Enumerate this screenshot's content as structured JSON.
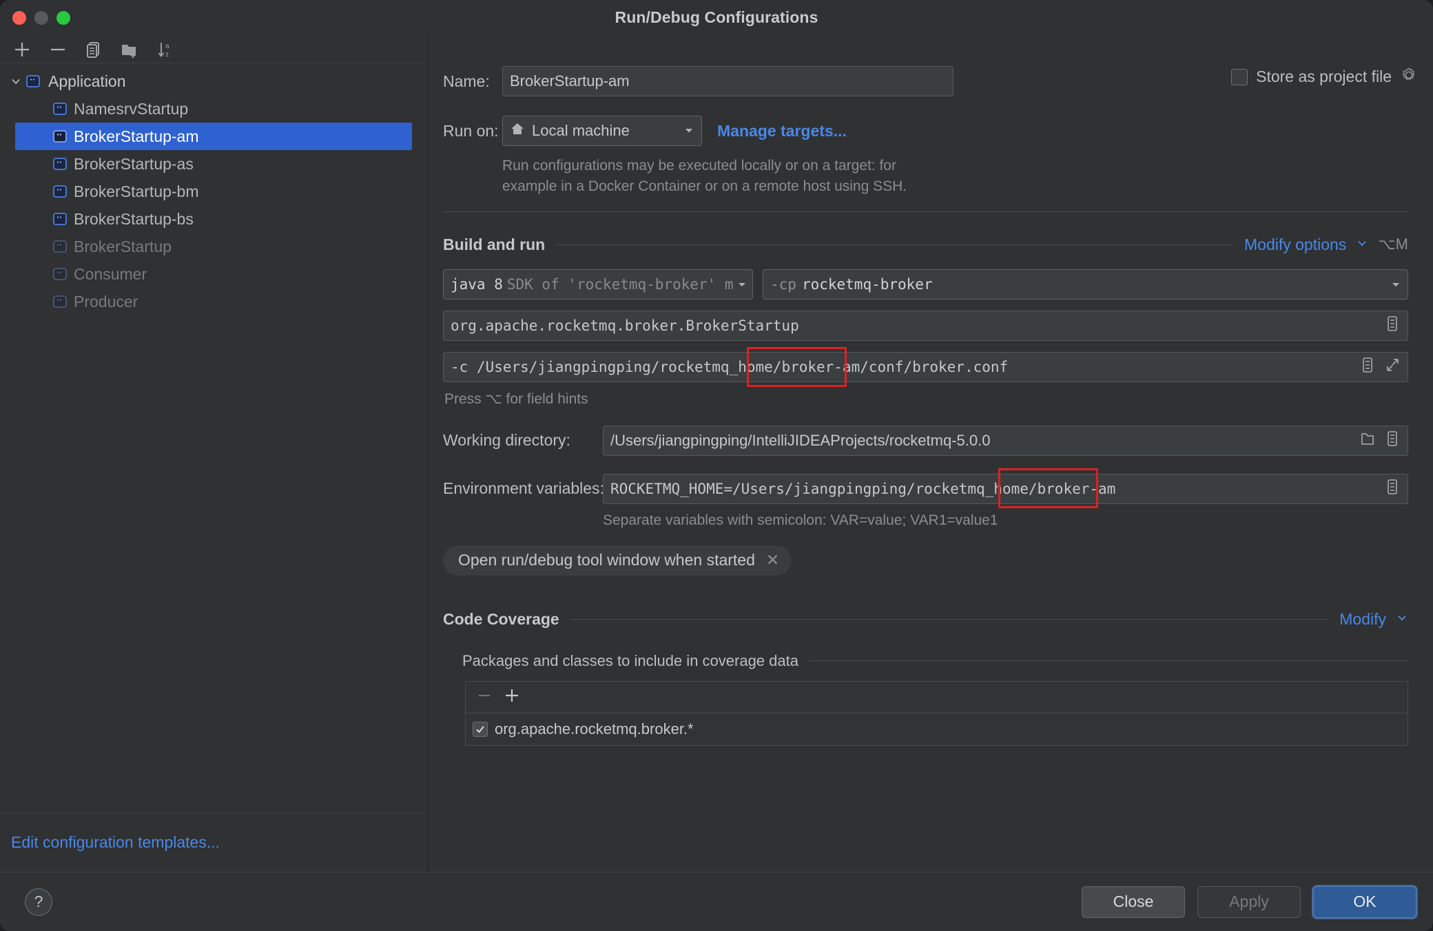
{
  "window": {
    "title": "Run/Debug Configurations",
    "traffic": {
      "close": "close-button",
      "minimize": "minimize-button",
      "zoom": "zoom-button"
    }
  },
  "sidebar": {
    "toolbar": [
      {
        "name": "add-configuration-button",
        "icon": "plus-icon"
      },
      {
        "name": "remove-configuration-button",
        "icon": "minus-icon"
      },
      {
        "name": "copy-configuration-button",
        "icon": "copy-icon"
      },
      {
        "name": "new-folder-button",
        "icon": "folder-add-icon"
      },
      {
        "name": "sort-configurations-button",
        "icon": "sort-az-icon"
      }
    ],
    "group": {
      "label": "Application",
      "expanded": true
    },
    "items": [
      {
        "label": "NamesrvStartup",
        "selected": false,
        "dimmed": false
      },
      {
        "label": "BrokerStartup-am",
        "selected": true,
        "dimmed": false
      },
      {
        "label": "BrokerStartup-as",
        "selected": false,
        "dimmed": false
      },
      {
        "label": "BrokerStartup-bm",
        "selected": false,
        "dimmed": false
      },
      {
        "label": "BrokerStartup-bs",
        "selected": false,
        "dimmed": false
      },
      {
        "label": "BrokerStartup",
        "selected": false,
        "dimmed": true
      },
      {
        "label": "Consumer",
        "selected": false,
        "dimmed": true
      },
      {
        "label": "Producer",
        "selected": false,
        "dimmed": true
      }
    ],
    "edit_templates_link": "Edit configuration templates..."
  },
  "form": {
    "name_label": "Name:",
    "name_value": "BrokerStartup-am",
    "store_as_project_file_label": "Store as project file",
    "store_as_project_file_checked": false,
    "run_on_label": "Run on:",
    "run_on_value": "Local machine",
    "manage_targets_link": "Manage targets...",
    "run_on_hint_line1": "Run configurations may be executed locally or on a target: for",
    "run_on_hint_line2": "example in a Docker Container or on a remote host using SSH."
  },
  "build_and_run": {
    "section_title": "Build and run",
    "modify_options_link": "Modify options",
    "modify_options_shortcut": "⌥M",
    "sdk_primary": "java 8",
    "sdk_secondary": "SDK of 'rocketmq-broker' mo",
    "classpath_flag": "-cp",
    "classpath_value": "rocketmq-broker",
    "main_class": "org.apache.rocketmq.broker.BrokerStartup",
    "program_arguments_prefix": "-c /Users/jiangpingping/rocketmq_home",
    "program_arguments_highlight": "/broker-am/",
    "program_arguments_suffix": "conf/broker.conf",
    "field_hints": "Press ⌥ for field hints",
    "working_directory_label": "Working directory:",
    "working_directory_value": "/Users/jiangpingping/IntelliJIDEAProjects/rocketmq-5.0.0",
    "environment_variables_label": "Environment variables:",
    "environment_variables_prefix": "ROCKETMQ_HOME=/Users/jiangpingping/rocketmq_home",
    "environment_variables_highlight": "/broker-am",
    "environment_variables_hint": "Separate variables with semicolon: VAR=value; VAR1=value1",
    "option_chip_label": "Open run/debug tool window when started"
  },
  "code_coverage": {
    "section_title": "Code Coverage",
    "modify_link": "Modify",
    "subsection_title": "Packages and classes to include in coverage data",
    "entries": [
      {
        "label": "org.apache.rocketmq.broker.*",
        "checked": true
      }
    ]
  },
  "footer": {
    "help_label": "?",
    "close_label": "Close",
    "apply_label": "Apply",
    "apply_enabled": false,
    "ok_label": "OK"
  },
  "colors": {
    "accent_blue": "#4a88e8",
    "selection_blue": "#2f62d0",
    "annotation_red": "#e02020",
    "primary_button": "#2f5b96",
    "window_bg": "#2f3133"
  }
}
